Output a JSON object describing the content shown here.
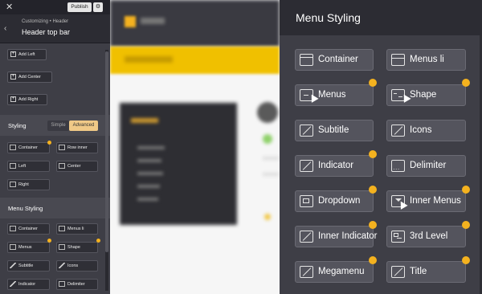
{
  "topbar": {
    "close_label": "✕",
    "publish_label": "Publish",
    "gear_label": "⚙"
  },
  "breadcrumb": {
    "path": "Customizing • Header",
    "title": "Header top bar",
    "back_label": "‹"
  },
  "add_buttons": [
    "Add Left",
    "Add Center",
    "Add Right"
  ],
  "styling": {
    "label": "Styling",
    "mode_simple": "Simple",
    "mode_advanced": "Advanced",
    "items": [
      "Container",
      "Row inner",
      "Left",
      "Center",
      "Right"
    ]
  },
  "menu_styling": {
    "label": "Menu Styling",
    "items": [
      "Container",
      "Menus li",
      "Menus",
      "Shape",
      "Subtitle",
      "Icons",
      "Indicator",
      "Delimiter"
    ]
  },
  "zoom": {
    "title": "Menu Styling",
    "items": [
      {
        "label": "Container",
        "icon": "container-icon",
        "dot": false
      },
      {
        "label": "Menus li",
        "icon": "menus-li-icon",
        "dot": false
      },
      {
        "label": "Menus",
        "icon": "menus-icon",
        "dot": true
      },
      {
        "label": "Shape",
        "icon": "shape-icon",
        "dot": true
      },
      {
        "label": "Subtitle",
        "icon": "pen-icon",
        "dot": false
      },
      {
        "label": "Icons",
        "icon": "pen-icon",
        "dot": false
      },
      {
        "label": "Indicator",
        "icon": "pen-icon",
        "dot": true
      },
      {
        "label": "Delimiter",
        "icon": "delimiter-icon",
        "dot": false
      },
      {
        "label": "Dropdown",
        "icon": "dropdown-icon",
        "dot": true
      },
      {
        "label": "Inner Menus",
        "icon": "inner-menus-icon",
        "dot": true
      },
      {
        "label": "Inner Indicator",
        "icon": "pen-icon",
        "dot": true
      },
      {
        "label": "3rd Level",
        "icon": "third-level-icon",
        "dot": true
      },
      {
        "label": "Megamenu",
        "icon": "pen-icon",
        "dot": true
      },
      {
        "label": "Title",
        "icon": "pen-icon",
        "dot": true
      }
    ]
  },
  "colors": {
    "accent": "#f4b21f",
    "panel": "#3e3e46",
    "advanced_tab": "#f0c987"
  }
}
